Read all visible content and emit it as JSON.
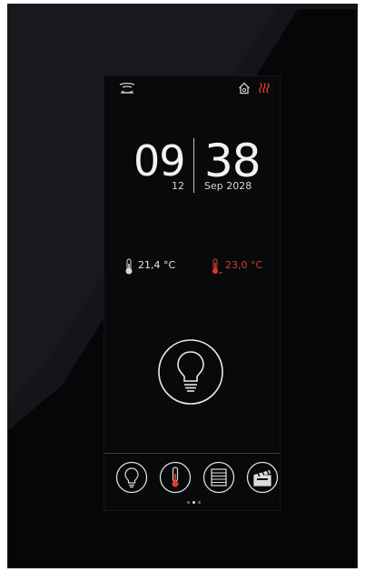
{
  "clock": {
    "hours": "09",
    "minutes": "38",
    "day": "12",
    "month_year": "Sep 2028"
  },
  "temperatures": {
    "indoor": {
      "value": "21,4 °C"
    },
    "setpoint": {
      "value": "23,0 °C"
    }
  },
  "topbar": {
    "left_icon": "signal-waves-icon",
    "home_icon": "home-icon",
    "heating_icon": "heating-icon"
  },
  "nav": {
    "items": [
      "light-bulb-icon",
      "thermometer-icon",
      "blinds-icon",
      "scene-clapper-icon"
    ]
  },
  "page_indicator": {
    "count": 3,
    "active": 2
  },
  "colors": {
    "accent_red": "#e03a2f",
    "text_white": "#f2f2f2",
    "background": "#08090b"
  }
}
